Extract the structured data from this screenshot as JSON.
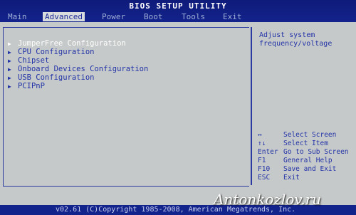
{
  "title": "BIOS SETUP UTILITY",
  "menu": [
    "Main",
    "Advanced",
    "Power",
    "Boot",
    "Tools",
    "Exit"
  ],
  "active_menu": "Advanced",
  "items": [
    "JumperFree Configuration",
    "CPU Configuration",
    "Chipset",
    "Onboard Devices Configuration",
    "USB Configuration",
    "PCIPnP"
  ],
  "selected_item": "JumperFree Configuration",
  "help": {
    "line1": "Adjust system",
    "line2": "frequency/voltage"
  },
  "keys": [
    {
      "key": "↔",
      "desc": "Select Screen"
    },
    {
      "key": "↑↓",
      "desc": "Select Item"
    },
    {
      "key": "Enter",
      "desc": "Go to Sub Screen"
    },
    {
      "key": "F1",
      "desc": "General Help"
    },
    {
      "key": "F10",
      "desc": "Save and Exit"
    },
    {
      "key": "ESC",
      "desc": "Exit"
    }
  ],
  "footer": "v02.61 (C)Copyright 1985-2008, American Megatrends, Inc.",
  "watermark": "Antonkozlov.ru",
  "colors": {
    "background": "#c6c9c9",
    "bar": "#13238c",
    "text": "#2233a8",
    "selected_text": "#ffffff"
  }
}
